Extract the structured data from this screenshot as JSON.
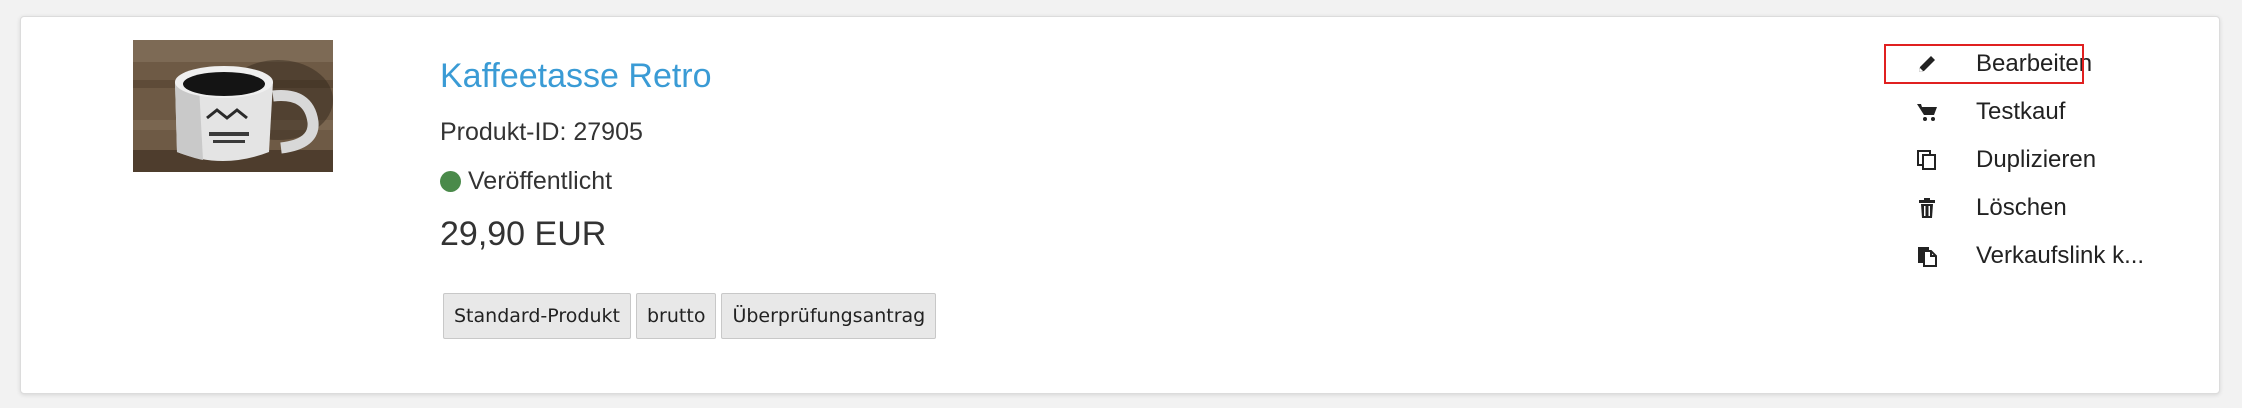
{
  "product": {
    "title": "Kaffeetasse Retro",
    "id_text": "Produkt-ID: 27905",
    "status_text": "Veröffentlicht",
    "status_color": "#4a8a4a",
    "price": "29,90 EUR",
    "tags": [
      "Standard-Produkt",
      "brutto",
      "Überprüfungsantrag"
    ]
  },
  "actions": [
    {
      "label": "Bearbeiten",
      "icon": "pencil-icon"
    },
    {
      "label": "Testkauf",
      "icon": "cart-icon"
    },
    {
      "label": "Duplizieren",
      "icon": "copy-icon"
    },
    {
      "label": "Löschen",
      "icon": "trash-icon"
    },
    {
      "label": "Verkaufslink k...",
      "icon": "link-copy-icon"
    }
  ],
  "colors": {
    "title": "#3a9bd5",
    "highlight": "#e02020"
  }
}
